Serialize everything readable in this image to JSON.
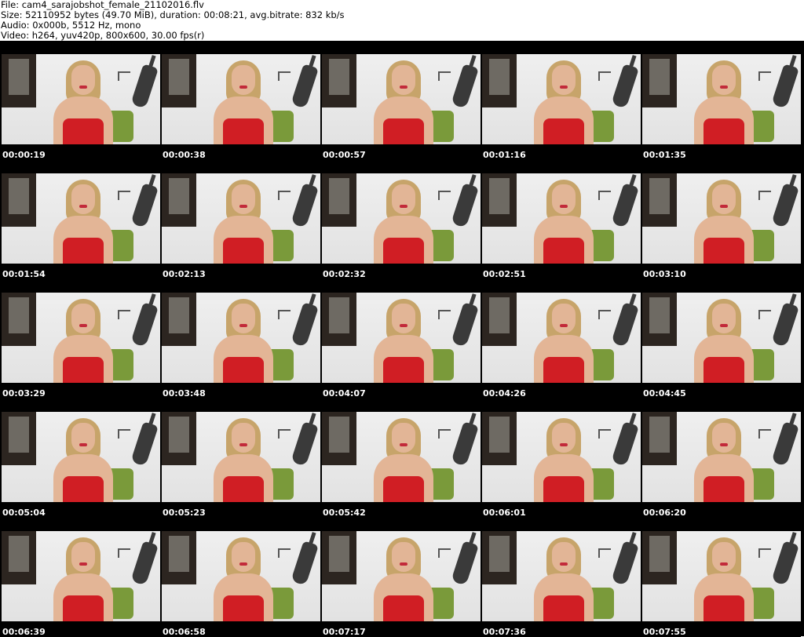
{
  "header": {
    "file_line": "File: cam4_sarajobshot_female_21102016.flv",
    "size_line": "Size: 52110952 bytes (49.70 MiB), duration: 00:08:21, avg.bitrate: 832 kb/s",
    "audio_line": "Audio: 0x000b, 5512 Hz, mono",
    "video_line": "Video: h264, yuv420p, 800x600, 30.00 fps(r)"
  },
  "thumbnails": [
    {
      "timestamp": "00:00:19"
    },
    {
      "timestamp": "00:00:38"
    },
    {
      "timestamp": "00:00:57"
    },
    {
      "timestamp": "00:01:16"
    },
    {
      "timestamp": "00:01:35"
    },
    {
      "timestamp": "00:01:54"
    },
    {
      "timestamp": "00:02:13"
    },
    {
      "timestamp": "00:02:32"
    },
    {
      "timestamp": "00:02:51"
    },
    {
      "timestamp": "00:03:10"
    },
    {
      "timestamp": "00:03:29"
    },
    {
      "timestamp": "00:03:48"
    },
    {
      "timestamp": "00:04:07"
    },
    {
      "timestamp": "00:04:26"
    },
    {
      "timestamp": "00:04:45"
    },
    {
      "timestamp": "00:05:04"
    },
    {
      "timestamp": "00:05:23"
    },
    {
      "timestamp": "00:05:42"
    },
    {
      "timestamp": "00:06:01"
    },
    {
      "timestamp": "00:06:20"
    },
    {
      "timestamp": "00:06:39"
    },
    {
      "timestamp": "00:06:58"
    },
    {
      "timestamp": "00:07:17"
    },
    {
      "timestamp": "00:07:36"
    },
    {
      "timestamp": "00:07:55"
    }
  ]
}
